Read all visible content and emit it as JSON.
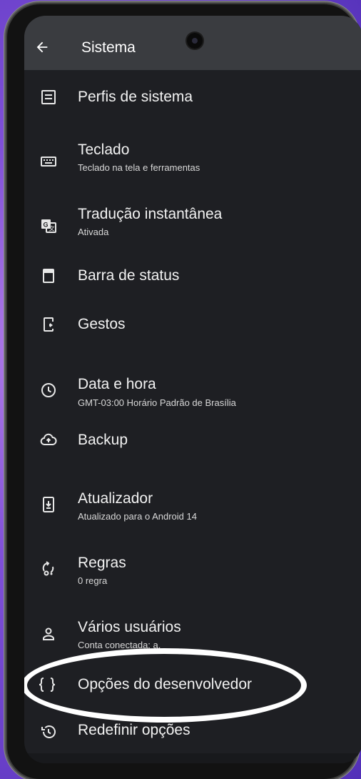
{
  "header": {
    "title": "Sistema",
    "back_icon": "arrow-left-icon"
  },
  "items": [
    {
      "label": "Perfis de sistema",
      "subtitle": "",
      "icon": "system-profile-icon"
    },
    {
      "label": "Teclado",
      "subtitle": "Teclado na tela e ferramentas",
      "icon": "keyboard-icon"
    },
    {
      "label": "Tradução instantânea",
      "subtitle": "Ativada",
      "icon": "translate-icon"
    },
    {
      "label": "Barra de status",
      "subtitle": "",
      "icon": "status-bar-icon"
    },
    {
      "label": "Gestos",
      "subtitle": "",
      "icon": "gestures-icon"
    },
    {
      "label": "Data e hora",
      "subtitle": "GMT-03:00 Horário Padrão de Brasília",
      "icon": "clock-icon"
    },
    {
      "label": "Backup",
      "subtitle": "",
      "icon": "cloud-upload-icon"
    },
    {
      "label": "Atualizador",
      "subtitle": "Atualizado para o Android 14",
      "icon": "system-update-icon"
    },
    {
      "label": "Regras",
      "subtitle": "0 regra",
      "icon": "rules-icon"
    },
    {
      "label": "Vários usuários",
      "subtitle": "Conta conectada: a.",
      "icon": "user-icon"
    },
    {
      "label": "Opções do desenvolvedor",
      "subtitle": "",
      "icon": "code-braces-icon"
    },
    {
      "label": "Redefinir opções",
      "subtitle": "",
      "icon": "history-icon"
    }
  ],
  "colors": {
    "background": "#1e1f23",
    "header": "#3a3c40",
    "text": "#f2f2f2",
    "highlight": "#ffffff"
  }
}
